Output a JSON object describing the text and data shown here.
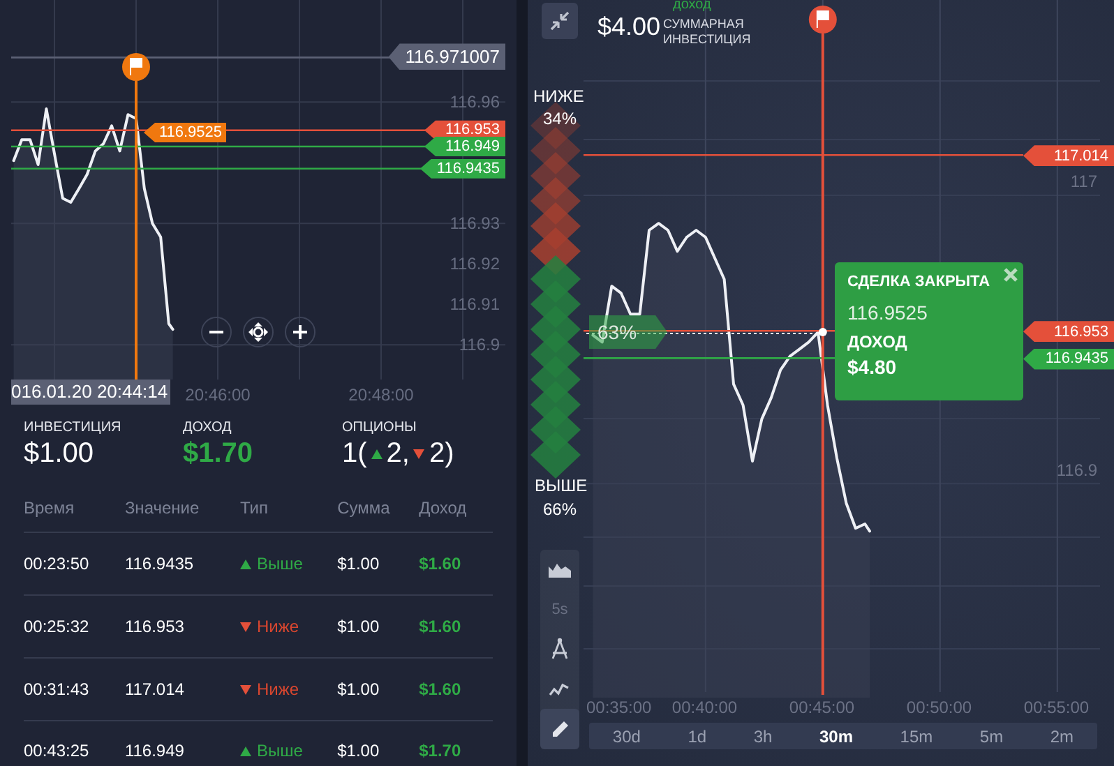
{
  "left_panel": {
    "chart": {
      "chart_data": {
        "type": "line",
        "grid": true,
        "xlim": [
          1243.47,
          1249.521
        ],
        "ylim": [
          116.7959,
          116.9852
        ],
        "x": [
          1243.5,
          1243.6,
          1243.7,
          1243.8,
          1243.9,
          1244.0,
          1244.1,
          1244.2,
          1244.3,
          1244.4,
          1244.5,
          1244.6,
          1244.7,
          1244.8,
          1244.9,
          1245.0,
          1245.1,
          1245.2,
          1245.3,
          1245.4,
          1245.45
        ],
        "series": [
          {
            "color": "#eef0f5",
            "values": [
              116.9455,
              116.9507,
              116.9507,
              116.9445,
              116.9583,
              116.9472,
              116.9362,
              116.9352,
              116.9386,
              116.9421,
              116.9479,
              116.9497,
              116.9541,
              116.9479,
              116.9569,
              116.9559,
              116.9386,
              116.93,
              116.9266,
              116.9052,
              116.9038
            ]
          }
        ],
        "xticks": [
          {
            "value": 1246,
            "label": "20:46:00"
          },
          {
            "value": 1248,
            "label": "20:48:00"
          }
        ],
        "yticks": [
          {
            "value": 116.96,
            "label": "116.96"
          },
          {
            "value": 116.93,
            "label": "116.93"
          },
          {
            "value": 116.92,
            "label": "116.92"
          },
          {
            "value": 116.91,
            "label": "116.91"
          },
          {
            "value": 116.9,
            "label": "116.9"
          }
        ],
        "ref_lines": [
          {
            "axis": "y",
            "value": 116.971007,
            "label": "116.971007",
            "color": "#5b6074"
          },
          {
            "axis": "y",
            "value": 116.953,
            "label": "116.953",
            "color": "#e4503a"
          },
          {
            "axis": "y",
            "value": 116.949,
            "label": "116.949",
            "color": "#2faa46"
          },
          {
            "axis": "y",
            "value": 116.9435,
            "label": "116.9435",
            "color": "#2faa46"
          },
          {
            "axis": "x",
            "value": 1245,
            "color": "#f0780f"
          }
        ]
      },
      "entry_tag": "116.9525",
      "cursor_time": "016.01.20 20:44:14"
    },
    "summary": [
      {
        "label": "ИНВЕСТИЦИЯ",
        "value": "$1.00",
        "kind": "plain"
      },
      {
        "label": "ДОХОД",
        "value": "$1.70",
        "kind": "income"
      }
    ],
    "options": {
      "label": "ОПЦИОНЫ",
      "count": "1(",
      "up": "2,",
      "down": "2)"
    },
    "table": {
      "columns": [
        "Время",
        "Значение",
        "Тип",
        "Сумма",
        "Доход"
      ],
      "rows": [
        {
          "time": "00:23:50",
          "value": "116.9435",
          "kind": "up",
          "type": "Выше",
          "amount": "$1.00",
          "income": "$1.60"
        },
        {
          "time": "00:25:32",
          "value": "116.953",
          "kind": "down",
          "type": "Ниже",
          "amount": "$1.00",
          "income": "$1.60"
        },
        {
          "time": "00:31:43",
          "value": "117.014",
          "kind": "down",
          "type": "Ниже",
          "amount": "$1.00",
          "income": "$1.60"
        },
        {
          "time": "00:43:25",
          "value": "116.949",
          "kind": "up",
          "type": "Выше",
          "amount": "$1.00",
          "income": "$1.70"
        }
      ]
    }
  },
  "right_panel": {
    "income_label": "доход",
    "total_investment": {
      "value": "$4.00",
      "label": "СУММАРНАЯ ИНВЕСТИЦИЯ"
    },
    "sentiment": {
      "down_label": "НИЖЕ",
      "down_percent": "34%",
      "up_label": "ВЫШЕ",
      "up_percent": "66%"
    },
    "chart": {
      "chart_data": {
        "type": "line",
        "grid": true,
        "xlim": [
          34.8,
          56.82
        ],
        "ylim": [
          116.802,
          117.0678
        ],
        "x": [
          35.2,
          35.6,
          36.0,
          36.4,
          36.8,
          37.2,
          37.6,
          38.0,
          38.4,
          38.8,
          39.2,
          39.6,
          40.0,
          40.4,
          40.8,
          41.2,
          41.6,
          42.0,
          42.4,
          42.8,
          43.2,
          43.6,
          44.0,
          44.4,
          44.8,
          45.2,
          45.6,
          46.0,
          46.4,
          46.8,
          47.0
        ],
        "series": [
          {
            "color": "#eef0f5",
            "values": [
              116.9515,
              116.9491,
              116.9685,
              116.9661,
              116.9588,
              116.9588,
              116.9879,
              116.9903,
              116.9879,
              116.9806,
              116.9855,
              116.9879,
              116.9855,
              116.9782,
              116.9709,
              116.9345,
              116.9272,
              116.9078,
              116.9224,
              116.9297,
              116.9394,
              116.9442,
              116.9466,
              116.9491,
              116.9525,
              116.9272,
              116.9088,
              116.8932,
              116.8845,
              116.886,
              116.8835
            ]
          }
        ],
        "xticks": [
          {
            "value": 35,
            "label": "00:35:00"
          },
          {
            "value": 40,
            "label": "00:40:00"
          },
          {
            "value": 45,
            "label": "00:45:00"
          },
          {
            "value": 50,
            "label": "00:50:00"
          },
          {
            "value": 55,
            "label": "00:55:00"
          }
        ],
        "yticks": [
          {
            "value": 117,
            "label": "117"
          },
          {
            "value": 116.9,
            "label": "116.9"
          }
        ],
        "ref_lines": [
          {
            "axis": "y",
            "value": 117.014,
            "label": "117.014",
            "color": "#e4503a"
          },
          {
            "axis": "y",
            "value": 116.953,
            "label": "116.953",
            "color": "#e4503a"
          },
          {
            "axis": "y",
            "value": 116.9435,
            "label": "116.9435",
            "color": "#2faa46"
          },
          {
            "axis": "x",
            "value": 45,
            "color": "#e4503a"
          }
        ]
      },
      "position_tag": "63%"
    },
    "deal_popup": {
      "title": "СДЕЛКА ЗАКРЫТА",
      "price": "116.9525",
      "income_label": "ДОХОД",
      "income": "$4.80"
    },
    "tools": [
      {
        "kind": "area",
        "selected": false
      },
      {
        "kind": "text",
        "label": "5s",
        "selected": false
      },
      {
        "kind": "compass",
        "selected": false
      },
      {
        "kind": "indicator",
        "selected": false
      },
      {
        "kind": "pencil",
        "selected": true
      }
    ],
    "timeframes": [
      {
        "label": "30d",
        "selected": false
      },
      {
        "label": "1d",
        "selected": false
      },
      {
        "label": "3h",
        "selected": false
      },
      {
        "label": "30m",
        "selected": true
      },
      {
        "label": "15m",
        "selected": false
      },
      {
        "label": "5m",
        "selected": false
      },
      {
        "label": "2m",
        "selected": false
      }
    ]
  }
}
